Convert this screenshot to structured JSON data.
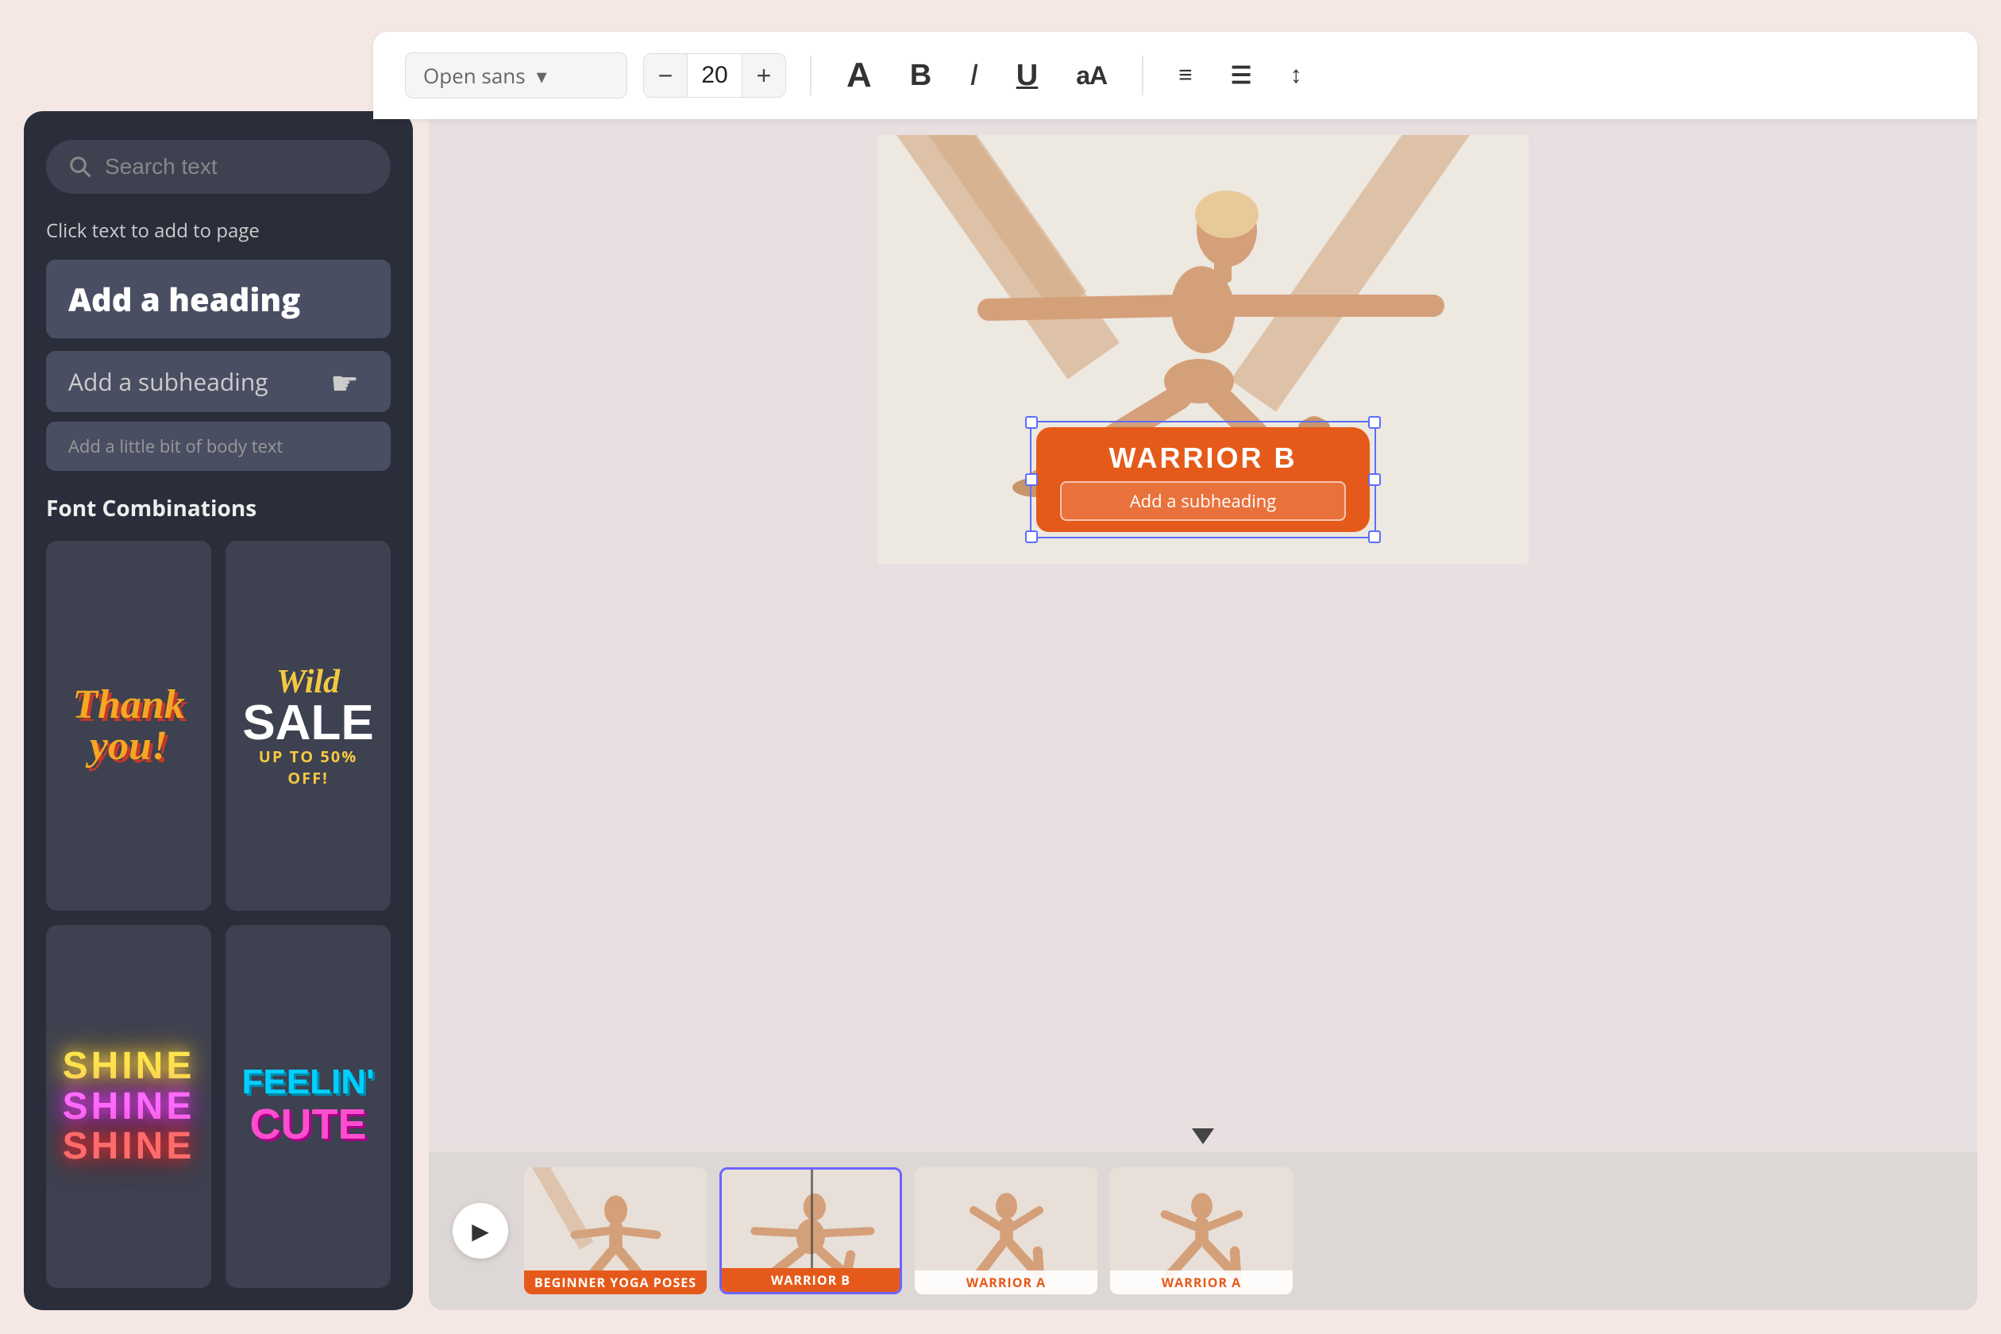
{
  "toolbar": {
    "font_name": "Open sans",
    "font_size": "20",
    "decrease_label": "−",
    "increase_label": "+",
    "bold_label": "B",
    "italic_label": "I",
    "underline_label": "U",
    "size_toggle_label": "aA",
    "align_label": "≡",
    "list_label": "≡",
    "spacing_label": "↕"
  },
  "sidebar": {
    "search_placeholder": "Search text",
    "click_label": "Click text to add to page",
    "heading_label": "Add a heading",
    "subheading_label": "Add a subheading",
    "body_label": "Add a little bit of body text",
    "combos_label": "Font Combinations",
    "combo1": {
      "line1": "Thank",
      "line2": "you!"
    },
    "combo2": {
      "line1": "Wild",
      "line2": "SALE",
      "line3": "UP TO 50% OFF!"
    },
    "combo3": {
      "lines": [
        "SHINE",
        "SHINE",
        "SHINE"
      ]
    },
    "combo4": {
      "line1": "FEELIN'",
      "line2": "CUTE"
    }
  },
  "canvas": {
    "warrior_title": "WARRIOR B",
    "warrior_subheading": "Add a subheading"
  },
  "filmstrip": {
    "play_label": "▶",
    "thumbs": [
      {
        "label": "BEGINNER YOGA POSES",
        "active": false,
        "style": "orange"
      },
      {
        "label": "WARRIOR B",
        "active": true,
        "style": "orange"
      },
      {
        "label": "WARRIOR A",
        "active": false,
        "style": "white"
      },
      {
        "label": "WARRIOR A",
        "active": false,
        "style": "white"
      }
    ]
  }
}
